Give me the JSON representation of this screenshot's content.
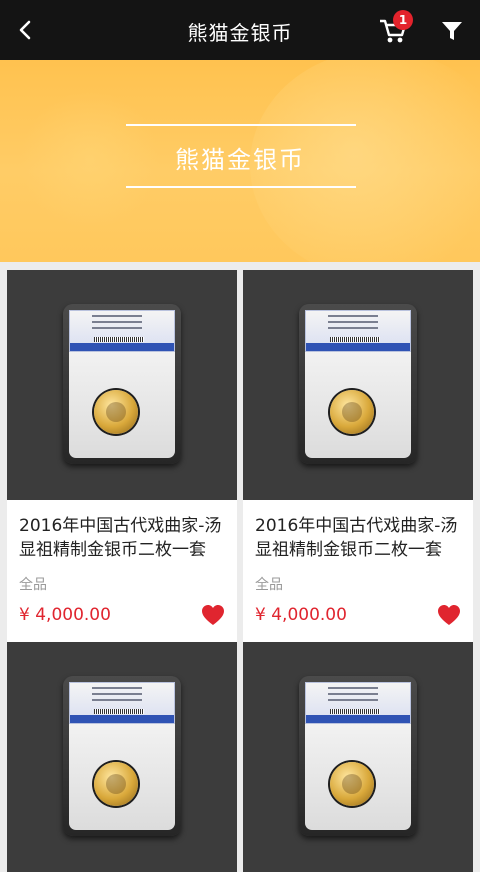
{
  "header": {
    "title": "熊猫金银币",
    "cart_badge": "1",
    "back_icon": "back-arrow-icon",
    "cart_icon": "shopping-cart-icon",
    "filter_icon": "filter-icon"
  },
  "banner": {
    "title": "熊猫金银币",
    "background_color": "#ffc85c"
  },
  "products": [
    {
      "name": "2016年中国古代戏曲家-汤显祖精制金银币二枚一套",
      "grade": "全品",
      "price": "¥ 4,000.00"
    },
    {
      "name": "2016年中国古代戏曲家-汤显祖精制金银币二枚一套",
      "grade": "全品",
      "price": "¥ 4,000.00"
    },
    {
      "name": "",
      "grade": "",
      "price": ""
    },
    {
      "name": "",
      "grade": "",
      "price": ""
    }
  ],
  "colors": {
    "accent_red": "#e0252f",
    "topbar": "#141414",
    "badge": "#e3232c"
  }
}
